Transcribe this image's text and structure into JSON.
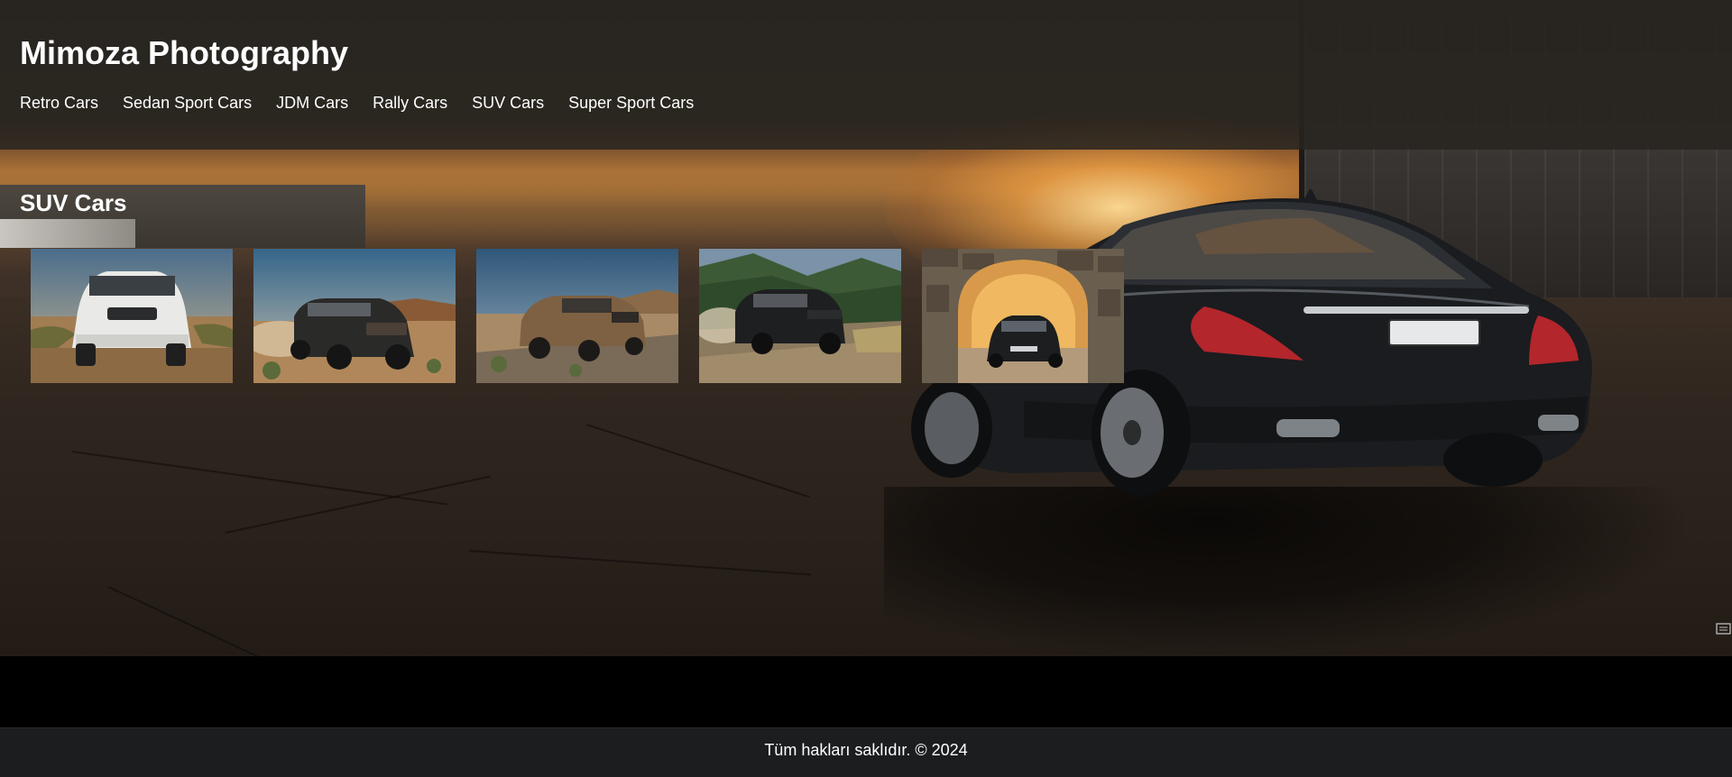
{
  "header": {
    "title": "Mimoza Photography",
    "nav": [
      "Retro Cars",
      "Sedan Sport Cars",
      "JDM Cars",
      "Rally Cars",
      "SUV Cars",
      "Super Sport Cars"
    ]
  },
  "section": {
    "title": "SUV Cars"
  },
  "gallery": {
    "items": [
      {
        "icon": "white-suv-desert-photo"
      },
      {
        "icon": "dark-suv-desert-dust-photo"
      },
      {
        "icon": "bronze-suv-desert-photo"
      },
      {
        "icon": "black-suv-mountain-road-photo"
      },
      {
        "icon": "black-suv-stone-arch-photo"
      }
    ]
  },
  "footer": {
    "text": "Tüm hakları saklıdır. © 2024"
  },
  "colors": {
    "header_bg": "#282420",
    "footer_bg": "#1b1d1f",
    "text": "#ffffff"
  }
}
